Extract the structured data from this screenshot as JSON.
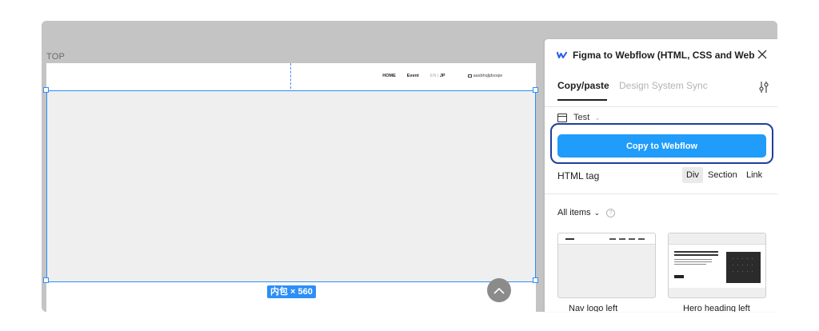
{
  "canvas": {
    "frame_label": "TOP",
    "site_nav": {
      "items": [
        "HOME",
        "Event"
      ],
      "lang_en": "EN",
      "lang_sep": "|",
      "lang_jp": "JP",
      "user": "aasbhqljdxoqw"
    },
    "size_badge": "内包 × 560",
    "scroll_up_icon": "chevron-up-icon"
  },
  "panel": {
    "title": "Figma to Webflow (HTML, CSS and Websit...",
    "tabs": [
      {
        "label": "Copy/paste",
        "active": true
      },
      {
        "label": "Design System Sync",
        "active": false
      }
    ],
    "selector": {
      "value": "Test"
    },
    "copy_button": "Copy to Webflow",
    "html_tag": {
      "label": "HTML tag",
      "options": [
        "Div",
        "Section",
        "Link"
      ],
      "selected": "Div"
    },
    "items_filter": {
      "label": "All items",
      "help": "?"
    },
    "templates": [
      {
        "label": "Nav logo left"
      },
      {
        "label": "Hero heading left"
      }
    ]
  },
  "colors": {
    "accent_blue": "#2c8ef8",
    "copy_button_bg": "#209cfa",
    "focus_ring": "#1f3f9b"
  }
}
